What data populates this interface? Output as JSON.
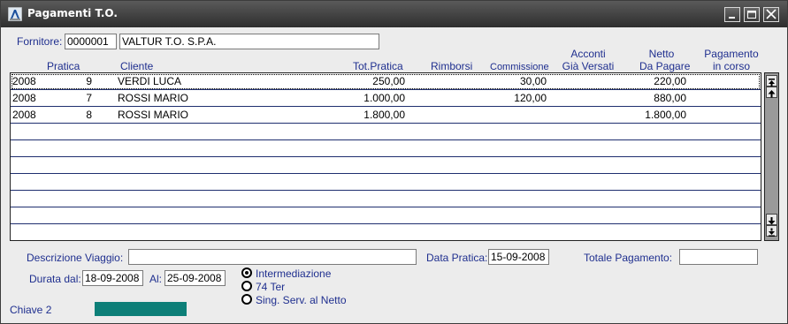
{
  "window": {
    "title": "Pagamenti T.O."
  },
  "supplier": {
    "label": "Fornitore:",
    "code": "0000001",
    "name": "VALTUR T.O. S.P.A."
  },
  "columns": {
    "pratica": "Pratica",
    "cliente": "Cliente",
    "tot_pratica": "Tot.Pratica",
    "rimborsi": "Rimborsi",
    "commissione": "Commissione",
    "acconti_1": "Acconti",
    "acconti_2": "Già Versati",
    "netto_1": "Netto",
    "netto_2": "Da Pagare",
    "pagamento_1": "Pagamento",
    "pagamento_2": "in corso"
  },
  "rows": [
    {
      "anno": "2008",
      "pratica": "9",
      "cliente": "VERDI LUCA",
      "tot_pratica": "250,00",
      "rimborsi": "",
      "commissione": "30,00",
      "acconti": "",
      "netto": "220,00",
      "pagamento": ""
    },
    {
      "anno": "2008",
      "pratica": "7",
      "cliente": "ROSSI MARIO",
      "tot_pratica": "1.000,00",
      "rimborsi": "",
      "commissione": "120,00",
      "acconti": "",
      "netto": "880,00",
      "pagamento": ""
    },
    {
      "anno": "2008",
      "pratica": "8",
      "cliente": "ROSSI MARIO",
      "tot_pratica": "1.800,00",
      "rimborsi": "",
      "commissione": "",
      "acconti": "",
      "netto": "1.800,00",
      "pagamento": ""
    }
  ],
  "footer": {
    "descrizione_label": "Descrizione Viaggio:",
    "descrizione_value": "",
    "data_pratica_label": "Data Pratica:",
    "data_pratica_value": "15-09-2008",
    "totale_label": "Totale Pagamento:",
    "totale_value": "",
    "durata_label": "Durata dal:",
    "durata_dal": "18-09-2008",
    "al_label": "Al:",
    "durata_al": "25-09-2008",
    "radio_options": [
      "Intermediazione",
      "74 Ter",
      "Sing. Serv. al Netto"
    ],
    "radio_selected": "Intermediazione",
    "chiave_label": "Chiave 2"
  },
  "colors": {
    "label": "#1f2f8f",
    "titlebar": "#3a3a3a",
    "accent_bar": "#0d7f78"
  },
  "icons": [
    "app-icon",
    "minimize-icon",
    "maximize-icon",
    "close-icon",
    "scroll-top-icon",
    "scroll-up-icon",
    "scroll-down-icon",
    "scroll-bottom-icon"
  ]
}
